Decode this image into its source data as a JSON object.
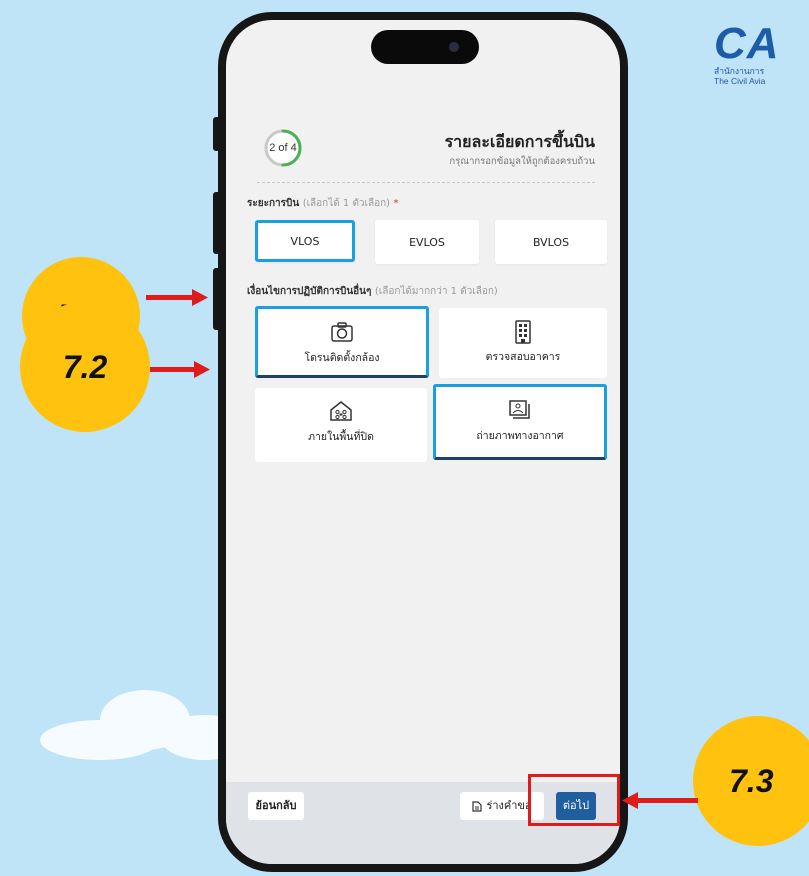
{
  "logo": {
    "mark": "CA",
    "line1": "สำนักงานการ",
    "line2": "The Civil Avia"
  },
  "header": {
    "step": "2 of 4",
    "step_progress": 0.5,
    "title": "รายละเอียดการขึ้นบิน",
    "subtitle": "กรุณากรอกข้อมูลให้ถูกต้องครบถ้วน"
  },
  "flight_range": {
    "label": "ระยะการบิน",
    "hint": "(เลือกได้ 1 ตัวเลือก)",
    "required_mark": "*",
    "options": [
      {
        "label": "VLOS",
        "selected": true
      },
      {
        "label": "EVLOS",
        "selected": false
      },
      {
        "label": "BVLOS",
        "selected": false
      }
    ]
  },
  "conditions": {
    "label": "เงื่อนไขการปฏิบัติการบินอื่นๆ",
    "hint": "(เลือกได้มากกว่า 1 ตัวเลือก)",
    "options": [
      {
        "label": "โดรนติดตั้งกล้อง",
        "icon": "camera-icon",
        "selected": true
      },
      {
        "label": "ตรวจสอบอาคาร",
        "icon": "building-icon",
        "selected": false
      },
      {
        "label": "ภายในพื้นที่ปิด",
        "icon": "indoor-house-icon",
        "selected": false
      },
      {
        "label": "ถ่ายภาพทางอากาศ",
        "icon": "aerial-photo-icon",
        "selected": true
      }
    ]
  },
  "footer": {
    "back": "ย้อนกลับ",
    "draft": "ร่างคำขอ",
    "draft_icon": "document-icon",
    "next": "ต่อไป"
  },
  "annotations": {
    "a1": "7.1",
    "a2": "7.2",
    "a3": "7.3"
  },
  "colors": {
    "background": "#bfe3f7",
    "badge": "#ffc20e",
    "arrow": "#e01b1b",
    "selection": "#1aa0df",
    "primary_button": "#1f5f9f",
    "progress": "#4caf50"
  }
}
